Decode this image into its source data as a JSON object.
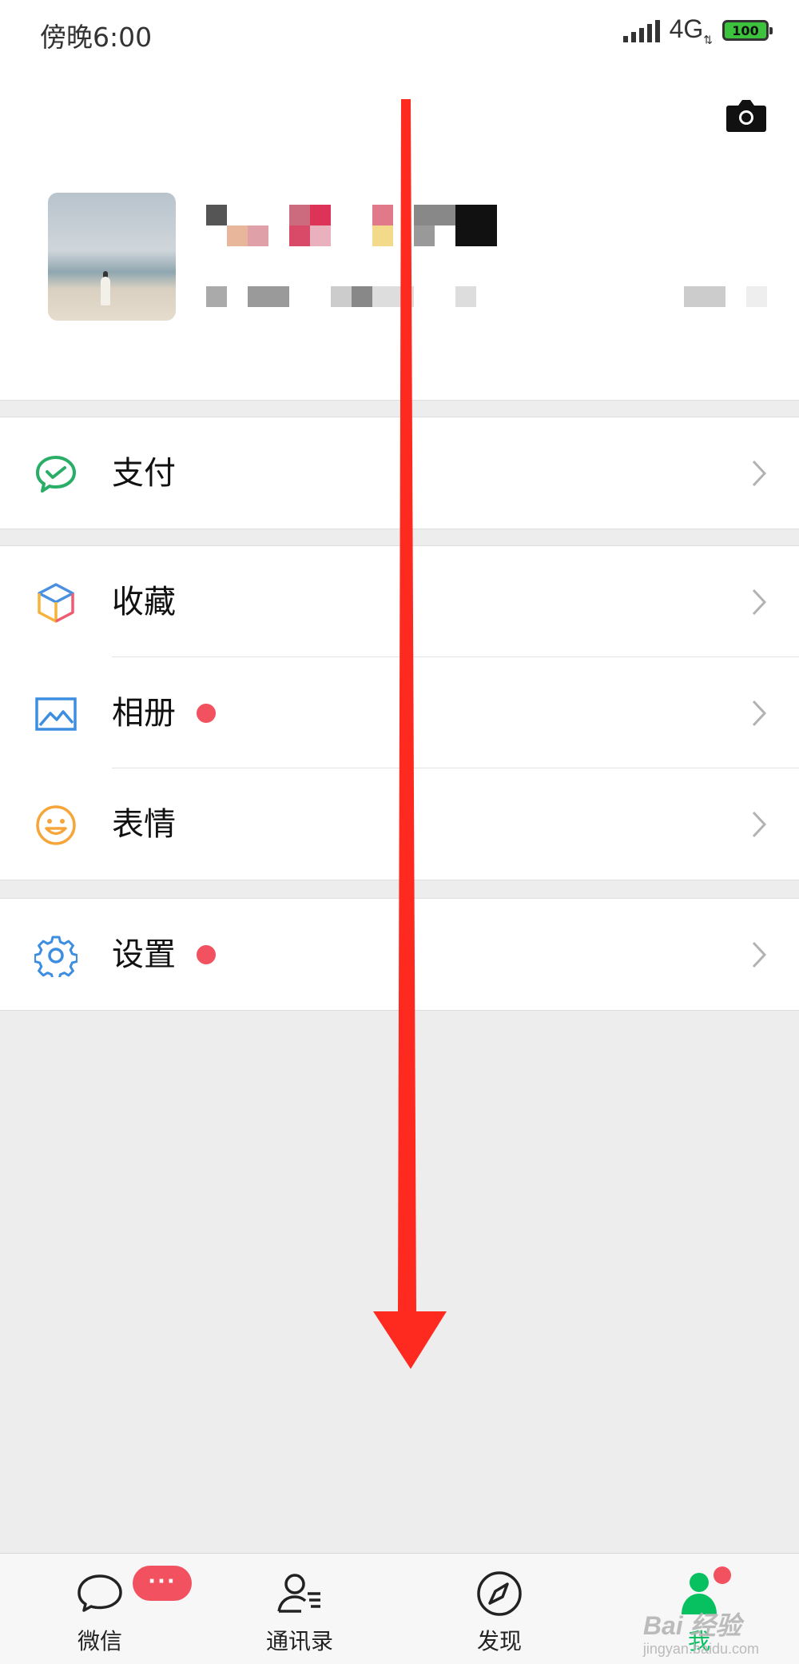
{
  "status_bar": {
    "time": "傍晚6:00",
    "network": "4G",
    "battery": "100"
  },
  "profile": {
    "camera_icon": "camera-icon",
    "avatar": "avatar"
  },
  "menu": {
    "pay": {
      "label": "支付",
      "icon": "wechat-pay-icon"
    },
    "favorites": {
      "label": "收藏",
      "icon": "cube-icon"
    },
    "album": {
      "label": "相册",
      "icon": "picture-icon",
      "has_dot": true
    },
    "stickers": {
      "label": "表情",
      "icon": "smiley-icon"
    },
    "settings": {
      "label": "设置",
      "icon": "gear-icon",
      "has_dot": true
    }
  },
  "tabbar": {
    "tabs": [
      {
        "label": "微信",
        "icon": "chat-bubble-icon",
        "badge": "···"
      },
      {
        "label": "通讯录",
        "icon": "contacts-icon"
      },
      {
        "label": "发现",
        "icon": "compass-icon"
      },
      {
        "label": "我",
        "icon": "me-icon",
        "active": true,
        "has_dot": true
      }
    ]
  },
  "watermark": {
    "text": "Bai 经验",
    "sub": "jingyan.baidu.com"
  },
  "colors": {
    "accent_green": "#07c160",
    "red_dot": "#f2525f",
    "arrow_red": "#ff2a1f"
  }
}
